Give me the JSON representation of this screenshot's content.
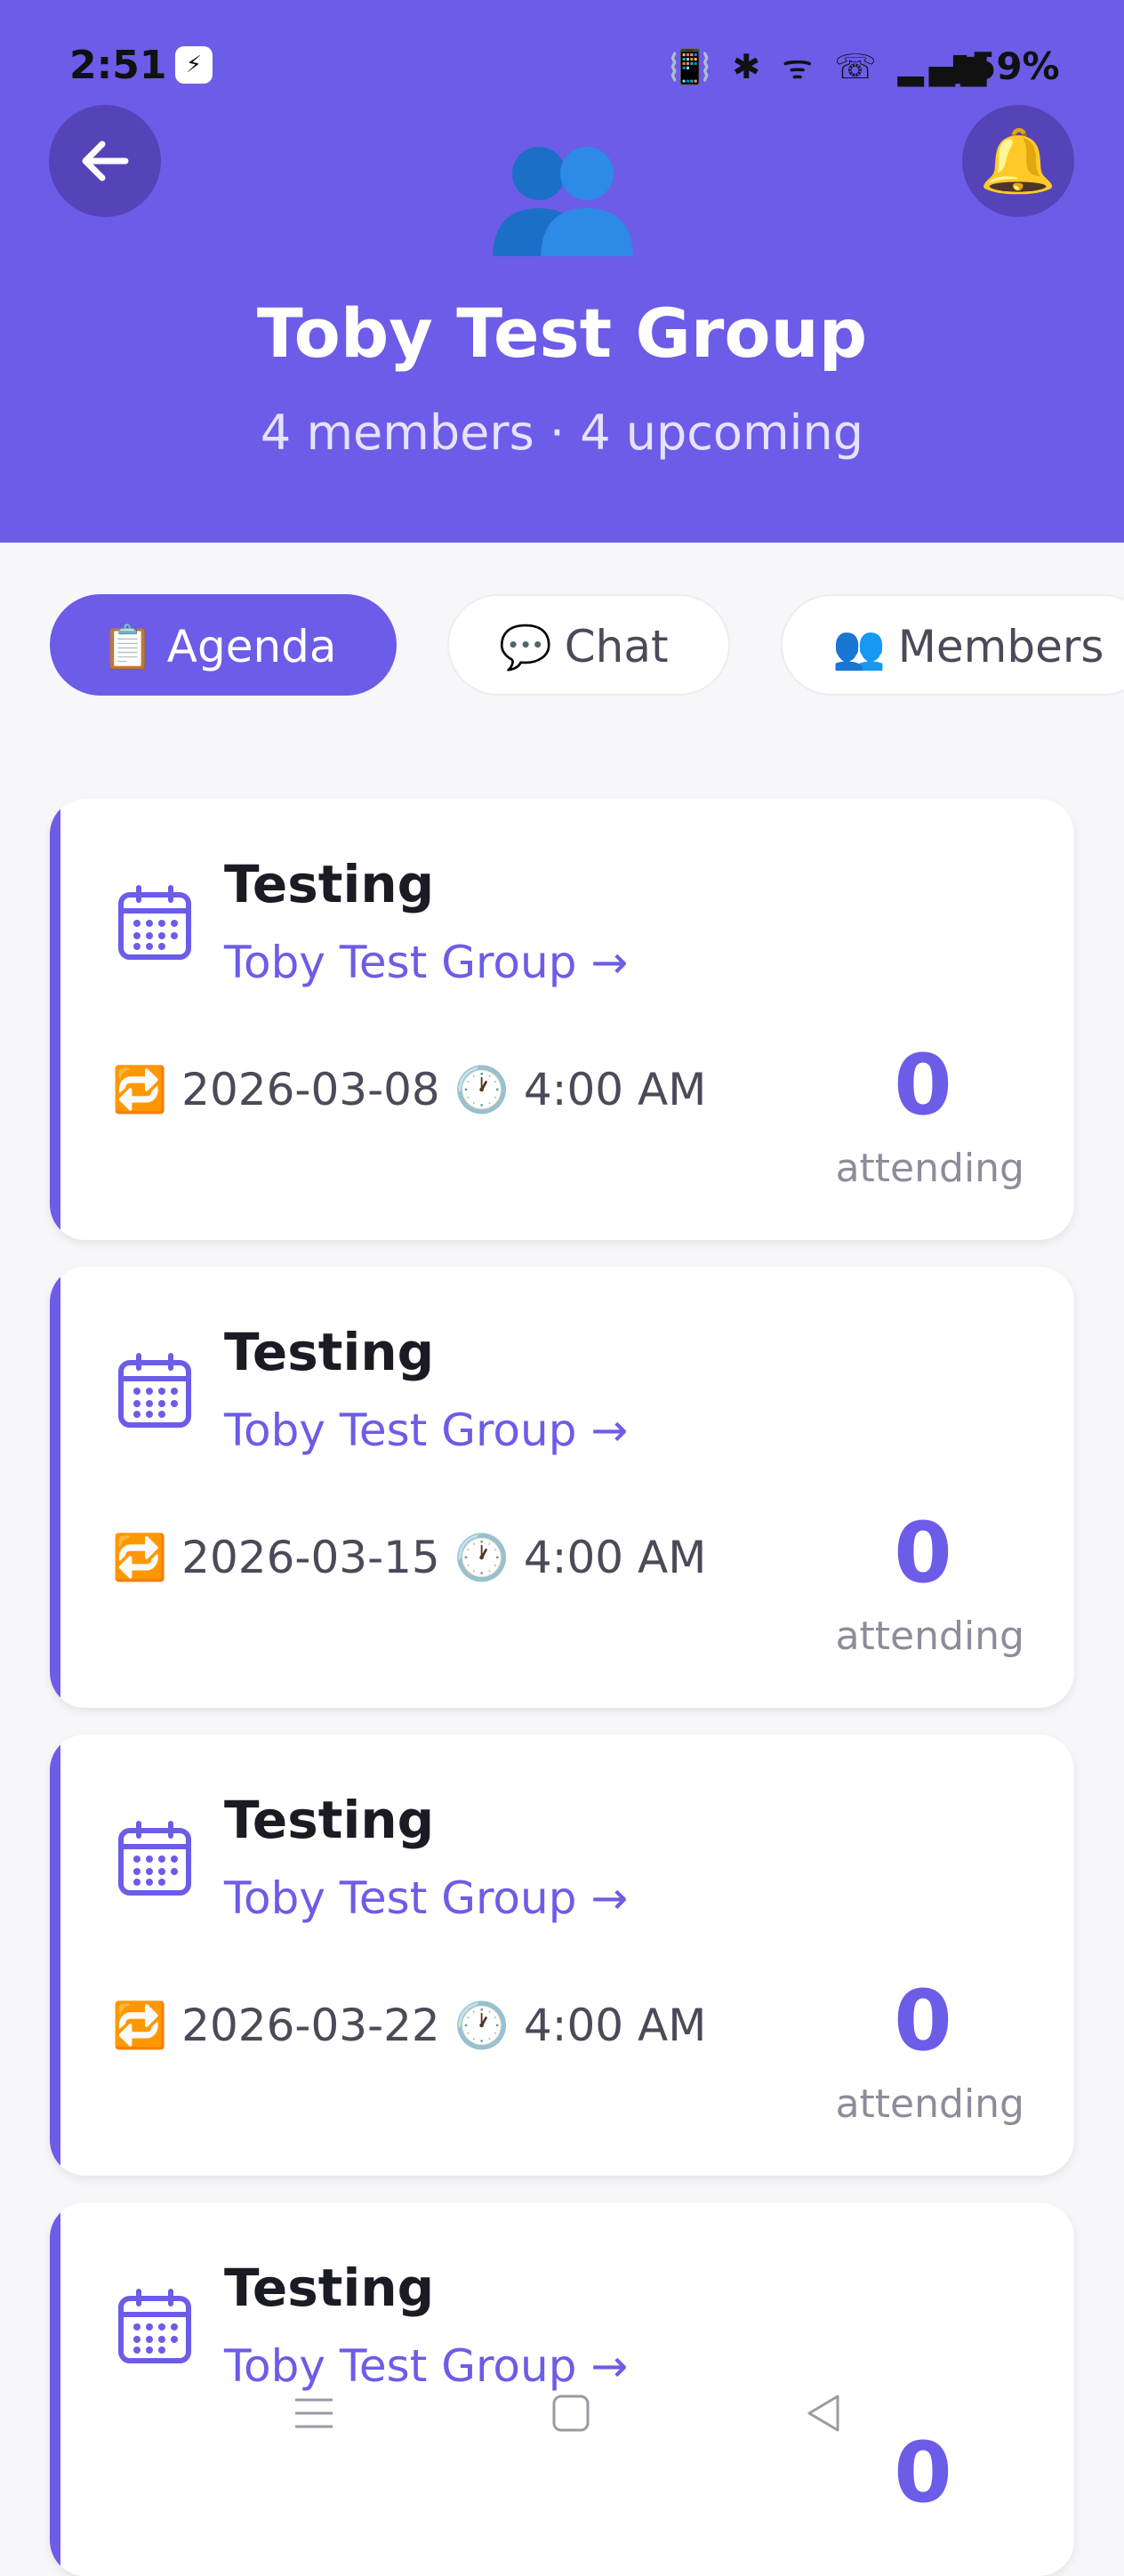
{
  "status": {
    "time": "2:51",
    "app_badge": "⚡",
    "icons": "📳 ✱ ᯤ ☏ ▂▄▆",
    "battery": "▮59%"
  },
  "header": {
    "title": "Toby Test Group",
    "subtitle": "4 members · 4 upcoming",
    "back_icon": "arrow-left-icon",
    "bell_icon": "🔔",
    "group_icon": "👥"
  },
  "tabs": [
    {
      "icon": "📋",
      "label": "Agenda",
      "active": true
    },
    {
      "icon": "💬",
      "label": "Chat",
      "active": false
    },
    {
      "icon": "👥",
      "label": "Members",
      "active": false
    }
  ],
  "events": [
    {
      "title": "Testing",
      "group": "Toby Test Group →",
      "repeat_icon": "🔁",
      "date": "2026-03-08",
      "clock_icon": "🕐",
      "time": "4:00 AM",
      "count": "0",
      "count_label": "attending"
    },
    {
      "title": "Testing",
      "group": "Toby Test Group →",
      "repeat_icon": "🔁",
      "date": "2026-03-15",
      "clock_icon": "🕐",
      "time": "4:00 AM",
      "count": "0",
      "count_label": "attending"
    },
    {
      "title": "Testing",
      "group": "Toby Test Group →",
      "repeat_icon": "🔁",
      "date": "2026-03-22",
      "clock_icon": "🕐",
      "time": "4:00 AM",
      "count": "0",
      "count_label": "attending"
    },
    {
      "title": "Testing",
      "group": "Toby Test Group →",
      "repeat_icon": "🔁",
      "date": "",
      "clock_icon": "",
      "time": "",
      "count": "0",
      "count_label": ""
    }
  ],
  "nav": [
    "menu-icon",
    "home-icon",
    "back-triangle-icon"
  ],
  "colors": {
    "accent": "#6c5ce7",
    "header_bg": "#6c5ce7",
    "page_bg": "#f7f7fa"
  }
}
